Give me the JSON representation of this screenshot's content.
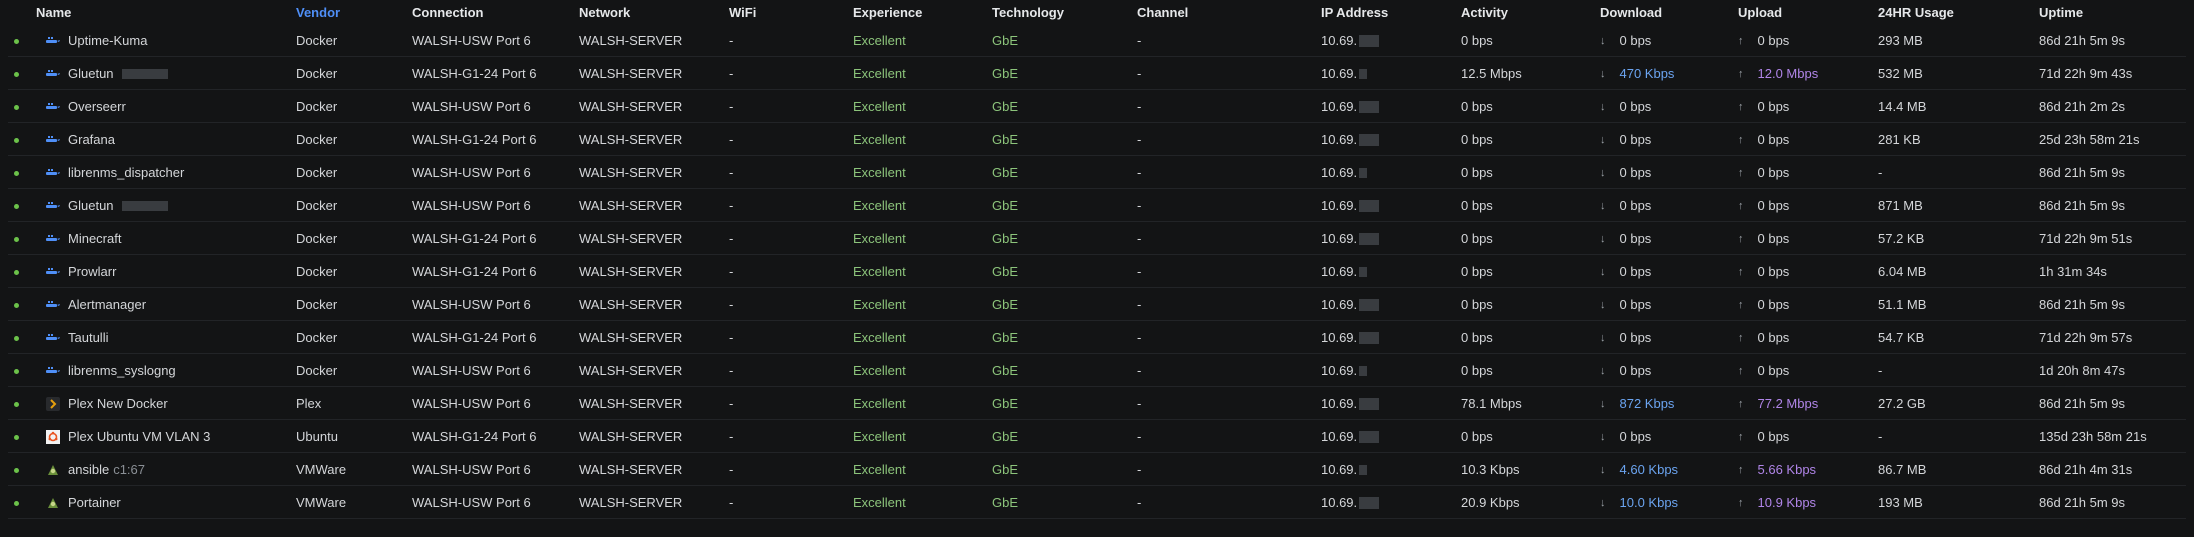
{
  "columns": {
    "name": "Name",
    "vendor": "Vendor",
    "connection": "Connection",
    "network": "Network",
    "wifi": "WiFi",
    "experience": "Experience",
    "technology": "Technology",
    "channel": "Channel",
    "ip": "IP Address",
    "activity": "Activity",
    "download": "Download",
    "upload": "Upload",
    "usage": "24HR Usage",
    "uptime": "Uptime"
  },
  "sorted_column": "vendor",
  "colors": {
    "background": "#131415",
    "sorted_header": "#4f8ff7",
    "online_dot": "#6cc24a",
    "experience": "#8cc47b",
    "download_active": "#6ba4f0",
    "upload_active": "#b085e8"
  },
  "rows": [
    {
      "name": "Uptime-Kuma",
      "suffix": "",
      "icon": "docker-icon",
      "blur_name": false,
      "vendor": "Docker",
      "connection": "WALSH-USW Port 6",
      "network": "WALSH-SERVER",
      "wifi": "-",
      "experience": "Excellent",
      "technology": "GbE",
      "channel": "-",
      "ip": "10.69.",
      "activity": "0 bps",
      "download": "0 bps",
      "download_active": false,
      "upload": "0 bps",
      "upload_active": false,
      "usage": "293 MB",
      "uptime": "86d 21h 5m 9s"
    },
    {
      "name": "Gluetun",
      "suffix": "",
      "icon": "docker-icon",
      "blur_name": true,
      "vendor": "Docker",
      "connection": "WALSH-G1-24 Port 6",
      "network": "WALSH-SERVER",
      "wifi": "-",
      "experience": "Excellent",
      "technology": "GbE",
      "channel": "-",
      "ip": "10.69.",
      "activity": "12.5 Mbps",
      "download": "470 Kbps",
      "download_active": true,
      "upload": "12.0 Mbps",
      "upload_active": true,
      "usage": "532 MB",
      "uptime": "71d 22h 9m 43s"
    },
    {
      "name": "Overseerr",
      "suffix": "",
      "icon": "docker-icon",
      "blur_name": false,
      "vendor": "Docker",
      "connection": "WALSH-USW Port 6",
      "network": "WALSH-SERVER",
      "wifi": "-",
      "experience": "Excellent",
      "technology": "GbE",
      "channel": "-",
      "ip": "10.69.",
      "activity": "0 bps",
      "download": "0 bps",
      "download_active": false,
      "upload": "0 bps",
      "upload_active": false,
      "usage": "14.4 MB",
      "uptime": "86d 21h 2m 2s"
    },
    {
      "name": "Grafana",
      "suffix": "",
      "icon": "docker-icon",
      "blur_name": false,
      "vendor": "Docker",
      "connection": "WALSH-G1-24 Port 6",
      "network": "WALSH-SERVER",
      "wifi": "-",
      "experience": "Excellent",
      "technology": "GbE",
      "channel": "-",
      "ip": "10.69.",
      "activity": "0 bps",
      "download": "0 bps",
      "download_active": false,
      "upload": "0 bps",
      "upload_active": false,
      "usage": "281 KB",
      "uptime": "25d 23h 58m 21s"
    },
    {
      "name": "librenms_dispatcher",
      "suffix": "",
      "icon": "docker-icon",
      "blur_name": false,
      "vendor": "Docker",
      "connection": "WALSH-USW Port 6",
      "network": "WALSH-SERVER",
      "wifi": "-",
      "experience": "Excellent",
      "technology": "GbE",
      "channel": "-",
      "ip": "10.69.",
      "activity": "0 bps",
      "download": "0 bps",
      "download_active": false,
      "upload": "0 bps",
      "upload_active": false,
      "usage": "-",
      "uptime": "86d 21h 5m 9s"
    },
    {
      "name": "Gluetun",
      "suffix": "",
      "icon": "docker-icon",
      "blur_name": true,
      "vendor": "Docker",
      "connection": "WALSH-USW Port 6",
      "network": "WALSH-SERVER",
      "wifi": "-",
      "experience": "Excellent",
      "technology": "GbE",
      "channel": "-",
      "ip": "10.69.",
      "activity": "0 bps",
      "download": "0 bps",
      "download_active": false,
      "upload": "0 bps",
      "upload_active": false,
      "usage": "871 MB",
      "uptime": "86d 21h 5m 9s"
    },
    {
      "name": "Minecraft",
      "suffix": "",
      "icon": "docker-icon",
      "blur_name": false,
      "vendor": "Docker",
      "connection": "WALSH-G1-24 Port 6",
      "network": "WALSH-SERVER",
      "wifi": "-",
      "experience": "Excellent",
      "technology": "GbE",
      "channel": "-",
      "ip": "10.69.",
      "activity": "0 bps",
      "download": "0 bps",
      "download_active": false,
      "upload": "0 bps",
      "upload_active": false,
      "usage": "57.2 KB",
      "uptime": "71d 22h 9m 51s"
    },
    {
      "name": "Prowlarr",
      "suffix": "",
      "icon": "docker-icon",
      "blur_name": false,
      "vendor": "Docker",
      "connection": "WALSH-G1-24 Port 6",
      "network": "WALSH-SERVER",
      "wifi": "-",
      "experience": "Excellent",
      "technology": "GbE",
      "channel": "-",
      "ip": "10.69.",
      "activity": "0 bps",
      "download": "0 bps",
      "download_active": false,
      "upload": "0 bps",
      "upload_active": false,
      "usage": "6.04 MB",
      "uptime": "1h 31m 34s"
    },
    {
      "name": "Alertmanager",
      "suffix": "",
      "icon": "docker-icon",
      "blur_name": false,
      "vendor": "Docker",
      "connection": "WALSH-USW Port 6",
      "network": "WALSH-SERVER",
      "wifi": "-",
      "experience": "Excellent",
      "technology": "GbE",
      "channel": "-",
      "ip": "10.69.",
      "activity": "0 bps",
      "download": "0 bps",
      "download_active": false,
      "upload": "0 bps",
      "upload_active": false,
      "usage": "51.1 MB",
      "uptime": "86d 21h 5m 9s"
    },
    {
      "name": "Tautulli",
      "suffix": "",
      "icon": "docker-icon",
      "blur_name": false,
      "vendor": "Docker",
      "connection": "WALSH-G1-24 Port 6",
      "network": "WALSH-SERVER",
      "wifi": "-",
      "experience": "Excellent",
      "technology": "GbE",
      "channel": "-",
      "ip": "10.69.",
      "activity": "0 bps",
      "download": "0 bps",
      "download_active": false,
      "upload": "0 bps",
      "upload_active": false,
      "usage": "54.7 KB",
      "uptime": "71d 22h 9m 57s"
    },
    {
      "name": "librenms_syslogng",
      "suffix": "",
      "icon": "docker-icon",
      "blur_name": false,
      "vendor": "Docker",
      "connection": "WALSH-USW Port 6",
      "network": "WALSH-SERVER",
      "wifi": "-",
      "experience": "Excellent",
      "technology": "GbE",
      "channel": "-",
      "ip": "10.69.",
      "activity": "0 bps",
      "download": "0 bps",
      "download_active": false,
      "upload": "0 bps",
      "upload_active": false,
      "usage": "-",
      "uptime": "1d 20h 8m 47s"
    },
    {
      "name": "Plex New Docker",
      "suffix": "",
      "icon": "plex-icon",
      "blur_name": false,
      "vendor": "Plex",
      "connection": "WALSH-USW Port 6",
      "network": "WALSH-SERVER",
      "wifi": "-",
      "experience": "Excellent",
      "technology": "GbE",
      "channel": "-",
      "ip": "10.69.",
      "activity": "78.1 Mbps",
      "download": "872 Kbps",
      "download_active": true,
      "upload": "77.2 Mbps",
      "upload_active": true,
      "usage": "27.2 GB",
      "uptime": "86d 21h 5m 9s"
    },
    {
      "name": "Plex Ubuntu VM VLAN 3",
      "suffix": "",
      "icon": "ubuntu-icon",
      "blur_name": false,
      "vendor": "Ubuntu",
      "connection": "WALSH-G1-24 Port 6",
      "network": "WALSH-SERVER",
      "wifi": "-",
      "experience": "Excellent",
      "technology": "GbE",
      "channel": "-",
      "ip": "10.69.",
      "activity": "0 bps",
      "download": "0 bps",
      "download_active": false,
      "upload": "0 bps",
      "upload_active": false,
      "usage": "-",
      "uptime": "135d 23h 58m 21s"
    },
    {
      "name": "ansible",
      "suffix": "c1:67",
      "icon": "vmware-icon",
      "blur_name": false,
      "vendor": "VMWare",
      "connection": "WALSH-USW Port 6",
      "network": "WALSH-SERVER",
      "wifi": "-",
      "experience": "Excellent",
      "technology": "GbE",
      "channel": "-",
      "ip": "10.69.",
      "activity": "10.3 Kbps",
      "download": "4.60 Kbps",
      "download_active": true,
      "upload": "5.66 Kbps",
      "upload_active": true,
      "usage": "86.7 MB",
      "uptime": "86d 21h 4m 31s"
    },
    {
      "name": "Portainer",
      "suffix": "",
      "icon": "vmware-icon",
      "blur_name": false,
      "vendor": "VMWare",
      "connection": "WALSH-USW Port 6",
      "network": "WALSH-SERVER",
      "wifi": "-",
      "experience": "Excellent",
      "technology": "GbE",
      "channel": "-",
      "ip": "10.69.",
      "activity": "20.9 Kbps",
      "download": "10.0 Kbps",
      "download_active": true,
      "upload": "10.9 Kbps",
      "upload_active": true,
      "usage": "193 MB",
      "uptime": "86d 21h 5m 9s"
    }
  ]
}
